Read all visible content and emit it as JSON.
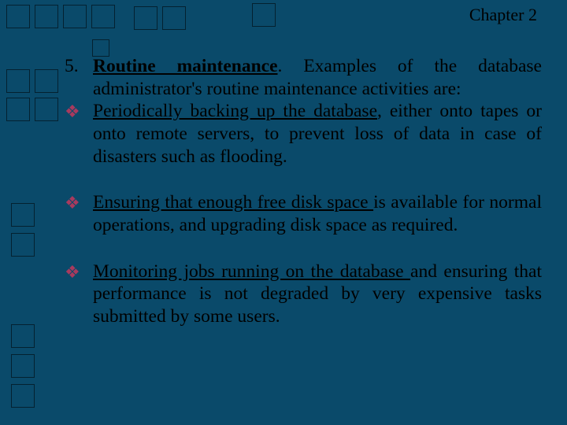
{
  "header": {
    "chapter": "Chapter 2"
  },
  "item": {
    "number": "5.",
    "title_u": "Routine maintenance",
    "title_rest": ". Examples of the database administrator's routine maintenance activities are:"
  },
  "bullets": [
    {
      "lead": " Periodically backing up the database",
      "rest": ", either onto tapes or onto remote servers, to prevent loss of data in case of disasters such as flooding."
    },
    {
      "lead": "Ensuring that enough free disk space ",
      "rest": "is available for normal operations, and upgrading disk space as required."
    },
    {
      "lead": "Monitoring jobs running on the database ",
      "rest": "and ensuring that performance is not degraded by very expensive tasks submitted by some users."
    }
  ],
  "icons": {
    "diamond": "❖"
  }
}
